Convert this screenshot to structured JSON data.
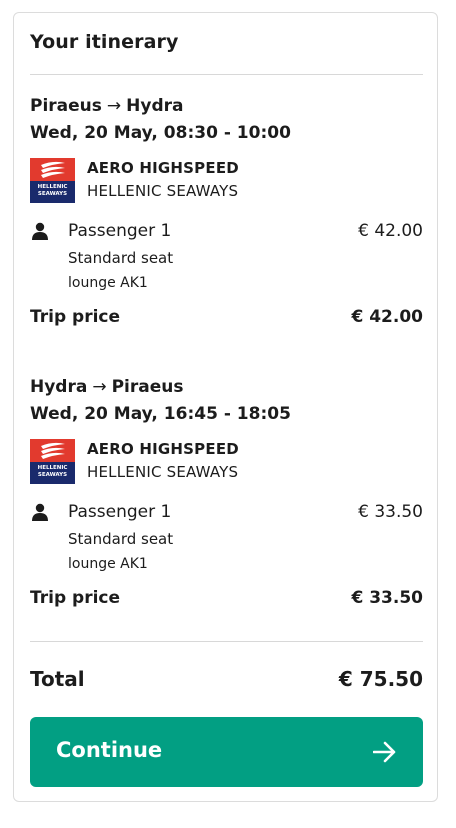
{
  "itinerary": {
    "title": "Your itinerary",
    "trips": [
      {
        "from": "Piraeus",
        "to": "Hydra",
        "arrow": "→",
        "datetime": "Wed, 20 May, 08:30 - 10:00",
        "operator": {
          "vessel": "AERO HIGHSPEED",
          "company": "HELLENIC SEAWAYS",
          "logo_text_line1": "HELLENIC",
          "logo_text_line2": "SEAWAYS"
        },
        "passenger": {
          "name": "Passenger 1",
          "price": "€ 42.00",
          "seat": "Standard seat",
          "accommodation": "lounge AK1"
        },
        "trip_price_label": "Trip price",
        "trip_price": "€ 42.00"
      },
      {
        "from": "Hydra",
        "to": "Piraeus",
        "arrow": "→",
        "datetime": "Wed, 20 May, 16:45 - 18:05",
        "operator": {
          "vessel": "AERO HIGHSPEED",
          "company": "HELLENIC SEAWAYS",
          "logo_text_line1": "HELLENIC",
          "logo_text_line2": "SEAWAYS"
        },
        "passenger": {
          "name": "Passenger 1",
          "price": "€ 33.50",
          "seat": "Standard seat",
          "accommodation": "lounge AK1"
        },
        "trip_price_label": "Trip price",
        "trip_price": "€ 33.50"
      }
    ],
    "total_label": "Total",
    "total": "€ 75.50",
    "continue_label": "Continue"
  },
  "colors": {
    "accent": "#029f83",
    "logo_red": "#e23a2e",
    "logo_navy": "#1a2a6c",
    "divider": "#d8d8d8",
    "text": "#1c1c1c"
  },
  "icons": {
    "passenger": "person-icon",
    "continue": "arrow-right-icon",
    "logo": "hellenic-seaways-logo"
  }
}
